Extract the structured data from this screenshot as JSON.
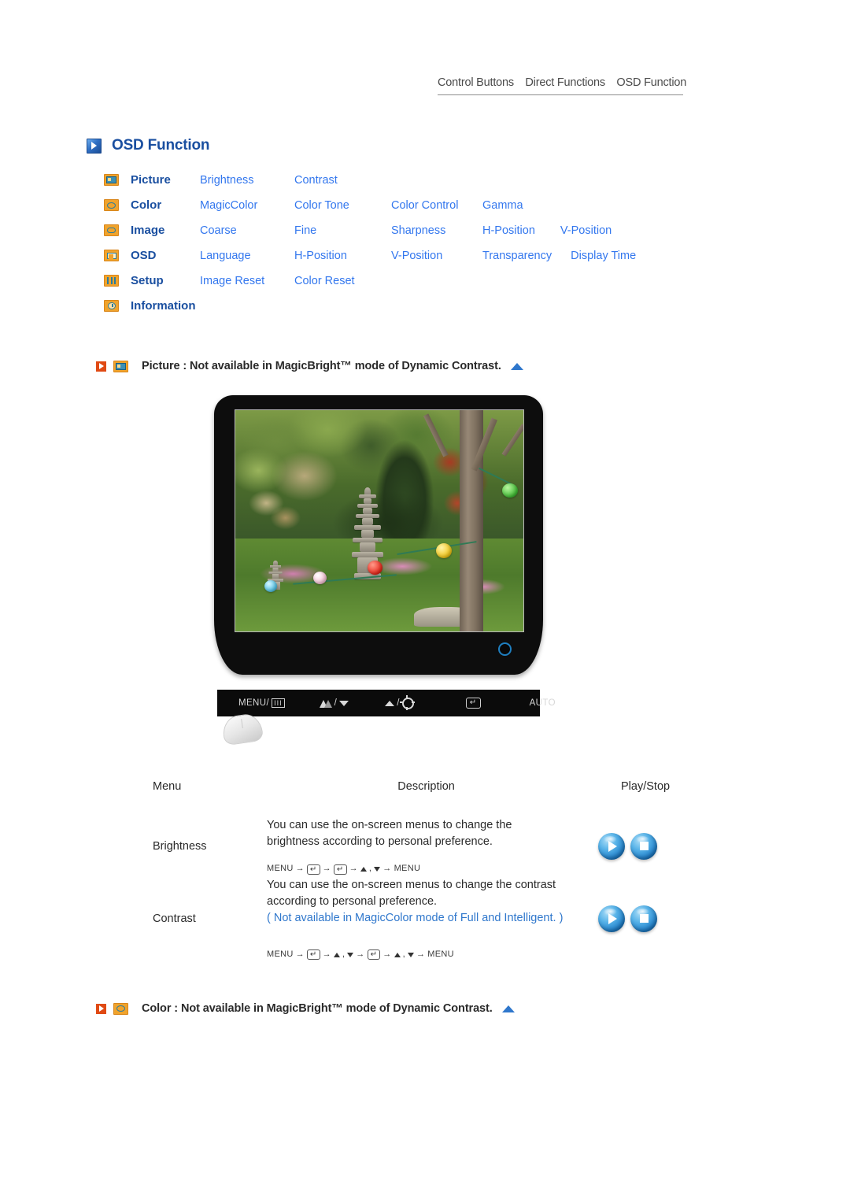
{
  "breadcrumb": {
    "items": [
      "Control Buttons",
      "Direct Functions",
      "OSD Function"
    ]
  },
  "page": {
    "title": "OSD Function",
    "title_icon": "blue-play-icon"
  },
  "menu_matrix": {
    "rows": [
      {
        "icon": "picture-icon",
        "name": "Picture",
        "subs": [
          "Brightness",
          "Contrast"
        ]
      },
      {
        "icon": "color-icon",
        "name": "Color",
        "subs": [
          "MagicColor",
          "Color Tone",
          "Color Control",
          "Gamma"
        ]
      },
      {
        "icon": "image-icon",
        "name": "Image",
        "subs": [
          "Coarse",
          "Fine",
          "Sharpness",
          "H-Position",
          "V-Position"
        ]
      },
      {
        "icon": "osd-icon",
        "name": "OSD",
        "subs": [
          "Language",
          "H-Position",
          "V-Position",
          "Transparency",
          "Display Time"
        ]
      },
      {
        "icon": "setup-icon",
        "name": "Setup",
        "subs": [
          "Image Reset",
          "Color Reset"
        ]
      },
      {
        "icon": "information-icon",
        "name": "Information",
        "subs": []
      }
    ]
  },
  "sections": [
    {
      "id": "picture",
      "icon": "picture-icon",
      "text": "Picture : Not available in MagicBright™ mode of Dynamic Contrast."
    },
    {
      "id": "color",
      "icon": "color-icon",
      "text": "Color : Not available in MagicBright™ mode of Dynamic Contrast."
    }
  ],
  "monitor": {
    "screen_alt": "Garden scene with stone pagoda, trees and colorful paper lanterns",
    "power_led": "power-led",
    "buttons": [
      {
        "id": "menu",
        "label": "MENU/",
        "glyph": "III"
      },
      {
        "id": "magicbright",
        "label": "",
        "glyph": "magicbright / down-arrow"
      },
      {
        "id": "brightness",
        "label": "",
        "glyph": "up-arrow / brightness-sun"
      },
      {
        "id": "enter",
        "label": "",
        "glyph": "enter-key"
      },
      {
        "id": "auto",
        "label": "AUTO",
        "glyph": ""
      }
    ]
  },
  "desc_table": {
    "headers": [
      "Menu",
      "Description",
      "Play/Stop"
    ],
    "rows": [
      {
        "menu": "Brightness",
        "desc_line1": "You can use the on-screen menus to change the",
        "desc_line2": "brightness according to personal preference.",
        "note": "",
        "nav": [
          "MENU",
          "→",
          "ENTER",
          "→",
          "ENTER",
          "→",
          "UPDOWN",
          "→",
          "MENU"
        ],
        "play_label": "play-button",
        "stop_label": "stop-button"
      },
      {
        "menu": "Contrast",
        "desc_line1": "You can use the on-screen menus to change the contrast",
        "desc_line2": "according to personal preference.",
        "note": "( Not available in MagicColor mode of Full and Intelligent. )",
        "nav": [
          "MENU",
          "→",
          "ENTER",
          "→",
          "UPDOWN",
          "→",
          "ENTER",
          "→",
          "UPDOWN",
          "→",
          "MENU"
        ],
        "play_label": "play-button",
        "stop_label": "stop-button"
      }
    ]
  },
  "colors": {
    "title_blue": "#1a4fa0",
    "link_blue": "#3377ee",
    "note_blue": "#2f77cc",
    "icon_orange": "#f0a32c",
    "red_marker": "#e04a14"
  }
}
